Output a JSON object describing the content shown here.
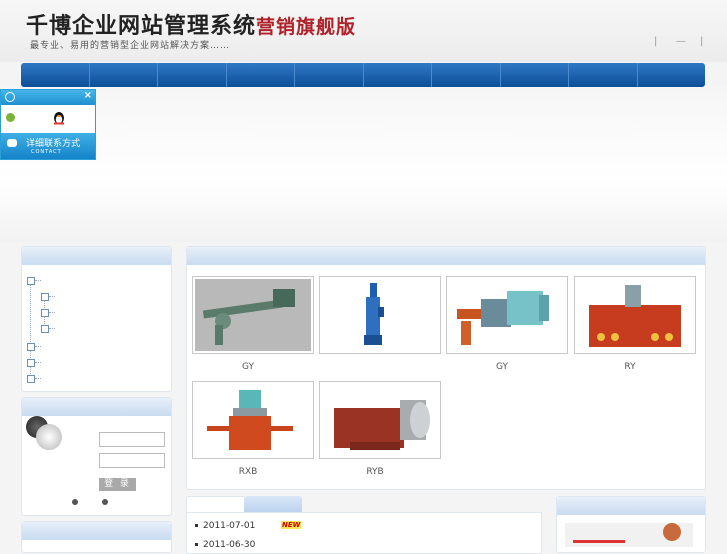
{
  "brand": {
    "name": "千博企业网站管理系统",
    "edition": "营销旗舰版",
    "slogan": "最专业、易用的营销型企业网站解决方案……"
  },
  "header_links": [
    "|",
    "—",
    "|"
  ],
  "nav": {
    "item_count": 10
  },
  "qq_widget": {
    "close": "×",
    "contact_label": "详细联系方式",
    "contact_sub": "CONTACT"
  },
  "login": {
    "button": "登 录"
  },
  "products": [
    {
      "name": "GY"
    },
    {
      "name": ""
    },
    {
      "name": "GY"
    },
    {
      "name": "RY"
    },
    {
      "name": "RXB"
    },
    {
      "name": "RYB"
    }
  ],
  "news": [
    {
      "date": "2011-07-01",
      "badge": "NEW"
    },
    {
      "date": "2011-06-30"
    }
  ],
  "colors": {
    "nav": "#1a5fab",
    "accent": "#b0222a",
    "panel_head": "#d6e4f4"
  }
}
